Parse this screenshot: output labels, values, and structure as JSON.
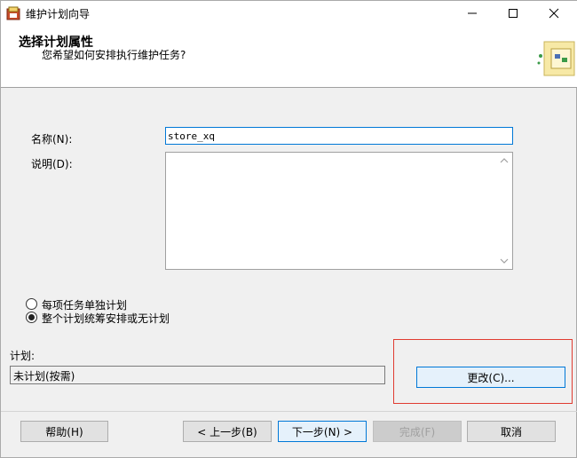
{
  "window": {
    "title": "维护计划向导",
    "controls": {
      "minimize": "—",
      "maximize": "☐",
      "close": "✕"
    }
  },
  "header": {
    "title": "选择计划属性",
    "subtitle": "您希望如何安排执行维护任务?"
  },
  "form": {
    "name_label": "名称(N):",
    "name_value": "store_xq",
    "desc_label": "说明(D):",
    "desc_value": "",
    "radio_separate": "每项任务单独计划",
    "radio_single": "整个计划统筹安排或无计划",
    "schedule_label": "计划:",
    "schedule_value": "未计划(按需)",
    "change_button": "更改(C)..."
  },
  "footer": {
    "help": "帮助(H)",
    "back": "< 上一步(B)",
    "next": "下一步(N) >",
    "finish": "完成(F)",
    "cancel": "取消"
  },
  "colors": {
    "accent": "#0078d7",
    "highlight": "#e03c31"
  },
  "icons": [
    "wizard-app-icon",
    "header-wizard-image",
    "scroll-up-icon",
    "scroll-down-icon"
  ]
}
